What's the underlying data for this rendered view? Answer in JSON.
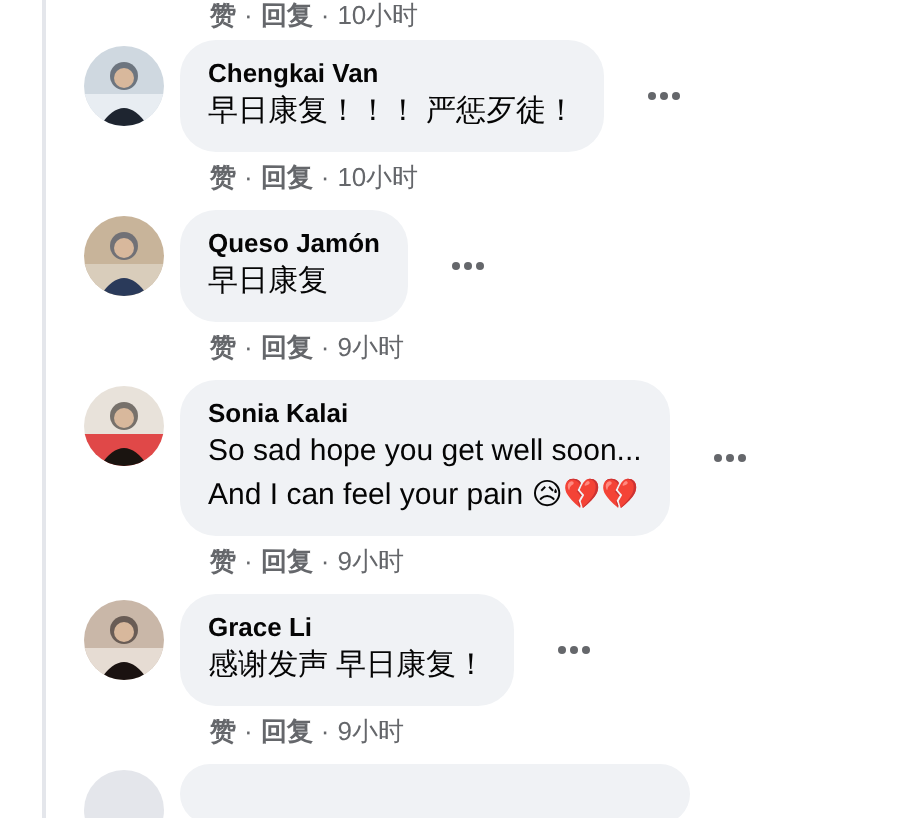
{
  "top_actions": [
    {
      "kind": "link",
      "text": "赞"
    },
    {
      "kind": "sep",
      "text": "·"
    },
    {
      "kind": "link",
      "text": "回复"
    },
    {
      "kind": "sep",
      "text": "·"
    },
    {
      "kind": "time",
      "text": "10小时"
    }
  ],
  "comments": [
    {
      "author": "Chengkai Van",
      "text": "早日康复！！！ 严惩歹徒！",
      "actions": [
        {
          "kind": "link",
          "text": "赞"
        },
        {
          "kind": "sep",
          "text": "·"
        },
        {
          "kind": "link",
          "text": "回复"
        },
        {
          "kind": "sep",
          "text": "·"
        },
        {
          "kind": "time",
          "text": "10小时"
        }
      ]
    },
    {
      "author": "Queso Jamón",
      "text": "早日康复",
      "actions": [
        {
          "kind": "link",
          "text": "赞"
        },
        {
          "kind": "sep",
          "text": "·"
        },
        {
          "kind": "link",
          "text": "回复"
        },
        {
          "kind": "sep",
          "text": "·"
        },
        {
          "kind": "time",
          "text": "9小时"
        }
      ]
    },
    {
      "author": "Sonia Kalai",
      "text": "So sad hope you get well soon...\nAnd I can feel your pain 😥💔💔",
      "actions": [
        {
          "kind": "link",
          "text": "赞"
        },
        {
          "kind": "sep",
          "text": "·"
        },
        {
          "kind": "link",
          "text": "回复"
        },
        {
          "kind": "sep",
          "text": "·"
        },
        {
          "kind": "time",
          "text": "9小时"
        }
      ]
    },
    {
      "author": "Grace Li",
      "text": "感谢发声 早日康复！",
      "actions": [
        {
          "kind": "link",
          "text": "赞"
        },
        {
          "kind": "sep",
          "text": "·"
        },
        {
          "kind": "link",
          "text": "回复"
        },
        {
          "kind": "sep",
          "text": "·"
        },
        {
          "kind": "time",
          "text": "9小时"
        }
      ]
    }
  ]
}
